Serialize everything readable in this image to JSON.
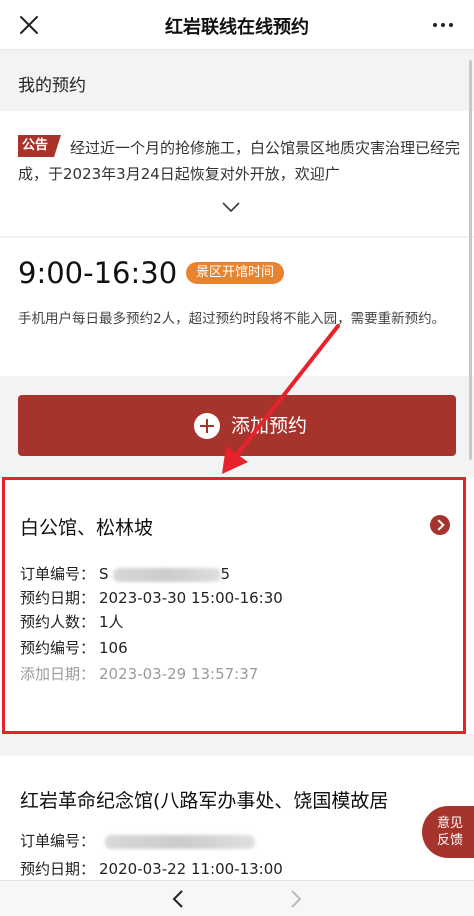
{
  "nav": {
    "title": "红岩联线在线预约",
    "close_icon": "close-icon",
    "more_icon": "more-icon"
  },
  "header": {
    "title": "我的预约"
  },
  "notice": {
    "badge": "公告",
    "text": "经过近一个月的抢修施工，白公馆景区地质灾害治理已经完成，于2023年3月24日起恢复对外开放，欢迎广",
    "expand_icon": "chevron-down-icon"
  },
  "hours": {
    "time": "9:00-16:30",
    "tag": "景区开馆时间",
    "note": "手机用户每日最多预约2人，超过预约时段将不能入园，需要重新预约。"
  },
  "add_button": {
    "label": "添加预约",
    "icon": "plus-icon"
  },
  "reservations": [
    {
      "title": "白公馆、松林坡",
      "order_label": "订单编号：",
      "order_value_visible": "S",
      "order_suffix": "5",
      "date_label": "预约日期：",
      "date_value": "2023-03-30 15:00-16:30",
      "people_label": "预约人数：",
      "people_value": "1人",
      "number_label": "预约编号：",
      "number_value": "106",
      "added_label": "添加日期：",
      "added_value": "2023-03-29 13:57:37"
    },
    {
      "title": "红岩革命纪念馆(八路军办事处、饶国模故居",
      "order_label": "订单编号：",
      "date_label": "预约日期：",
      "date_value": "2020-03-22 11:00-13:00"
    }
  ],
  "feedback": {
    "line1": "意见",
    "line2": "反馈"
  },
  "bottom": {
    "back_icon": "chevron-left-icon",
    "forward_icon": "chevron-right-icon"
  },
  "colors": {
    "brand": "#a6342c",
    "tag": "#e8842f",
    "annotation": "#e8222a"
  }
}
